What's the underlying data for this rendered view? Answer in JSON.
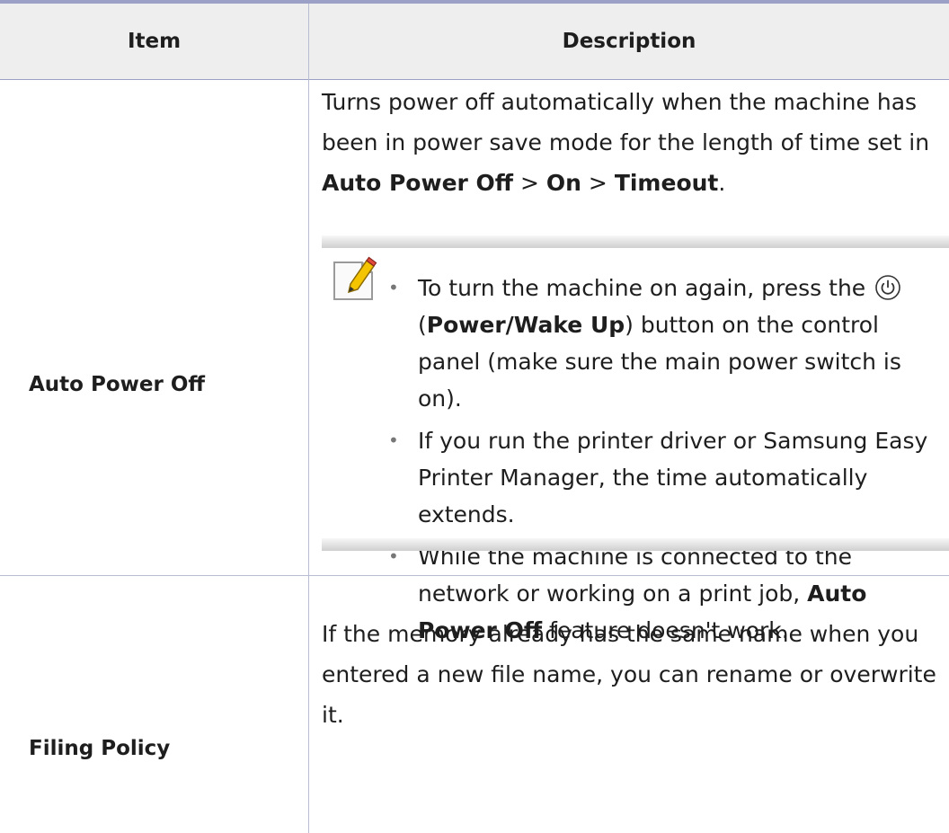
{
  "table": {
    "headers": {
      "item": "Item",
      "description": "Description"
    },
    "rows": [
      {
        "item": "Auto Power Off",
        "description": {
          "p1": "Turns power off automatically when the machine has been in power save mode for the length of time set in ",
          "path_a": "Auto Power Off",
          "sep1": " > ",
          "path_b": "On",
          "sep2": " > ",
          "path_c": "Timeout",
          "end": "."
        },
        "note": {
          "icon": "note-pencil-icon",
          "bullet_char": "•",
          "b1": {
            "pre": "To turn the machine on again, press the ",
            "icon": "power-icon",
            "open": " (",
            "bold": "Power/Wake Up",
            "post": ") button on the control panel (make sure the main power switch is on)."
          },
          "b2": {
            "text": "If you run the printer driver or Samsung Easy Printer Manager, the time automatically extends."
          },
          "b3": {
            "pre": "While the machine is connected to the network or working on a print job, ",
            "bold": "Auto Power Off",
            "post": " feature doesn't work."
          }
        }
      },
      {
        "item": "Filing Policy",
        "description": {
          "text": "If the memory already has the same name when you entered a new file name, you can rename or overwrite it."
        }
      }
    ]
  }
}
